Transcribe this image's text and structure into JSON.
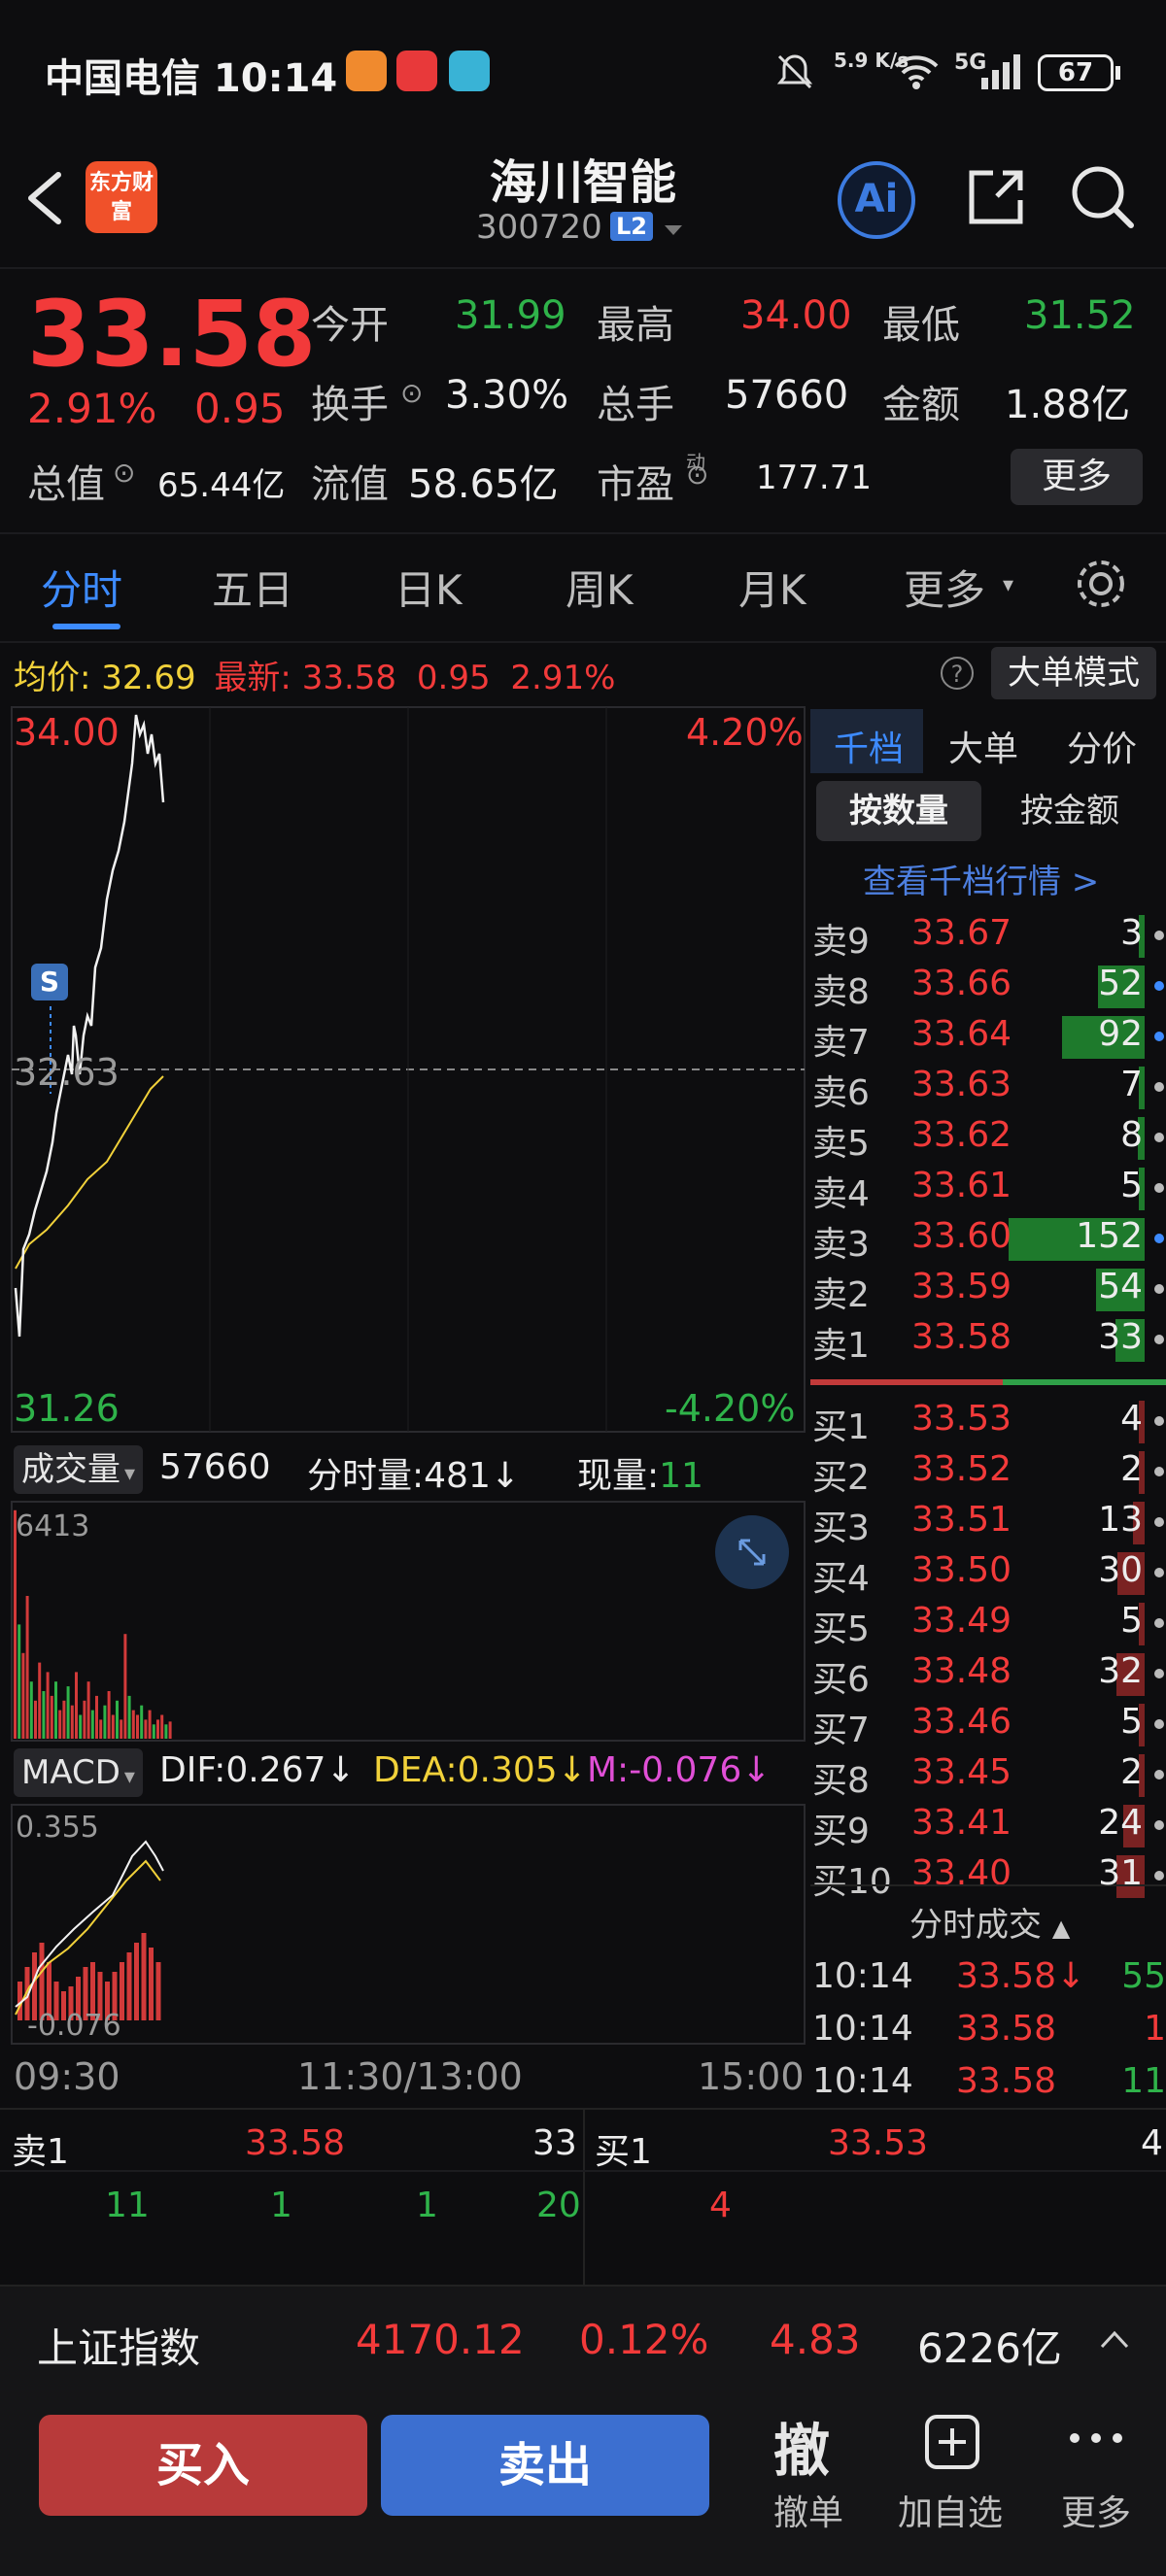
{
  "status_bar": {
    "carrier": "中国电信 10:14",
    "network_speed": "5.9 K/s",
    "signal": "5G",
    "battery": "67"
  },
  "header": {
    "back_icon": "chevron-left-icon",
    "logo": "东方财富",
    "title": "海川智能",
    "code": "300720",
    "level_badge": "L2",
    "ai_label": "Ai",
    "share_icon": "share-icon",
    "search_icon": "search-icon"
  },
  "quote": {
    "price": "33.58",
    "change_pct": "2.91%",
    "change": "0.95",
    "open_label": "今开",
    "open": "31.99",
    "high_label": "最高",
    "high": "34.00",
    "low_label": "最低",
    "low": "31.52",
    "turnover_label": "换手",
    "turnover": "3.30%",
    "volume_label": "总手",
    "volume": "57660",
    "amount_label": "金额",
    "amount": "1.88亿",
    "total_mv_label": "总值",
    "total_mv": "65.44亿",
    "float_mv_label": "流值",
    "float_mv": "58.65亿",
    "pe_label": "市盈",
    "pe_sup": "动",
    "pe": "177.71",
    "more_label": "更多"
  },
  "tabs": [
    "分时",
    "五日",
    "日K",
    "周K",
    "月K",
    "更多"
  ],
  "info_line": {
    "avg_label": "均价:",
    "avg": "32.69",
    "latest_label": "最新:",
    "latest": "33.58",
    "chg": "0.95",
    "pct": "2.91%",
    "big_order_mode": "大单模式"
  },
  "chart_labels": {
    "price_top": "34.00",
    "price_mid": "32.63",
    "price_bottom": "31.26",
    "pct_top": "4.20%",
    "pct_bottom": "-4.20%",
    "s_marker": "S"
  },
  "volume_panel": {
    "select": "成交量",
    "total": "57660",
    "minute_label": "分时量:",
    "minute": "481",
    "minute_arrow": "↓",
    "now_label": "现量:",
    "now": "11",
    "scale_top": "6413"
  },
  "macd_panel": {
    "select": "MACD",
    "dif": "DIF:0.267",
    "dea": "DEA:0.305",
    "m": "M:-0.076",
    "arrow": "↓",
    "scale_top": "0.355",
    "scale_bottom": "-0.076"
  },
  "time_axis": [
    "09:30",
    "11:30/13:00",
    "15:00"
  ],
  "order_book": {
    "tabs": [
      "千档",
      "大单",
      "分价"
    ],
    "seg": [
      "按数量",
      "按金额"
    ],
    "link": "查看千档行情 >",
    "asks": [
      {
        "label": "卖9",
        "price": "33.67",
        "vol": "3"
      },
      {
        "label": "卖8",
        "price": "33.66",
        "vol": "52"
      },
      {
        "label": "卖7",
        "price": "33.64",
        "vol": "92"
      },
      {
        "label": "卖6",
        "price": "33.63",
        "vol": "7"
      },
      {
        "label": "卖5",
        "price": "33.62",
        "vol": "8"
      },
      {
        "label": "卖4",
        "price": "33.61",
        "vol": "5"
      },
      {
        "label": "卖3",
        "price": "33.60",
        "vol": "152"
      },
      {
        "label": "卖2",
        "price": "33.59",
        "vol": "54"
      },
      {
        "label": "卖1",
        "price": "33.58",
        "vol": "33"
      }
    ],
    "bids": [
      {
        "label": "买1",
        "price": "33.53",
        "vol": "4"
      },
      {
        "label": "买2",
        "price": "33.52",
        "vol": "2"
      },
      {
        "label": "买3",
        "price": "33.51",
        "vol": "13"
      },
      {
        "label": "买4",
        "price": "33.50",
        "vol": "30"
      },
      {
        "label": "买5",
        "price": "33.49",
        "vol": "5"
      },
      {
        "label": "买6",
        "price": "33.48",
        "vol": "32"
      },
      {
        "label": "买7",
        "price": "33.46",
        "vol": "5"
      },
      {
        "label": "买8",
        "price": "33.45",
        "vol": "2"
      },
      {
        "label": "买9",
        "price": "33.41",
        "vol": "24"
      },
      {
        "label": "买10",
        "price": "33.40",
        "vol": "31"
      }
    ],
    "ticks_title": "分时成交",
    "ticks": [
      {
        "time": "10:14",
        "price": "33.58↓",
        "vol": "55"
      },
      {
        "time": "10:14",
        "price": "33.58",
        "vol": "1"
      },
      {
        "time": "10:14",
        "price": "33.58",
        "vol": "11"
      }
    ]
  },
  "bottom_quote": {
    "ask_label": "卖1",
    "ask_price": "33.58",
    "ask_vol": "33",
    "bid_label": "买1",
    "bid_price": "33.53",
    "bid_vol": "4",
    "ask_queue": [
      "11",
      "1",
      "1",
      "20"
    ],
    "bid_queue": [
      "4"
    ]
  },
  "index_bar": {
    "name": "上证指数",
    "value": "4170.12",
    "pct": "0.12%",
    "chg": "4.83",
    "amount": "6226亿"
  },
  "actions": {
    "buy": "买入",
    "sell": "卖出",
    "cancel_glyph": "撤",
    "cancel": "撤单",
    "watch": "加自选",
    "more": "更多"
  },
  "colors": {
    "up": "#f23a3a",
    "down": "#2fb34a",
    "accent": "#3d8bff",
    "avg_line": "#f1d13a"
  }
}
